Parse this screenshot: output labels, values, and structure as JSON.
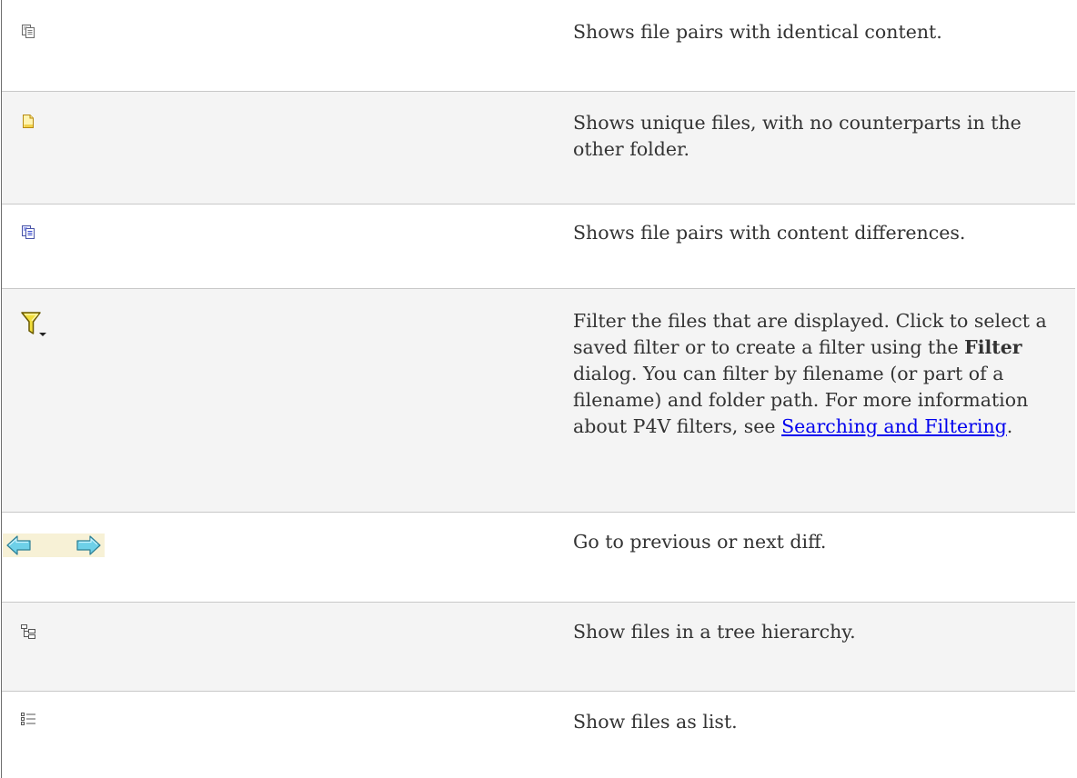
{
  "rows": [
    {
      "icon": "identical-files-icon",
      "description": "Shows file pairs with identical content."
    },
    {
      "icon": "unique-file-icon",
      "description": "Shows unique files, with no counterparts in the other folder."
    },
    {
      "icon": "different-files-icon",
      "description": "Shows file pairs with content differences."
    },
    {
      "icon": "filter-funnel-icon",
      "description_parts": {
        "before_bold": "Filter the files that are displayed. Click to select a saved filter or to create a filter using the ",
        "bold": "Filter",
        "after_bold": " dialog. You can filter by filename (or part of a filename) and folder path. For more information about P4V filters, see ",
        "link": "Searching and Filtering",
        "after_link": "."
      }
    },
    {
      "icon": "previous-next-arrows-icon",
      "description": "Go to previous or next diff."
    },
    {
      "icon": "tree-hierarchy-icon",
      "description": "Show files in a tree hierarchy."
    },
    {
      "icon": "list-view-icon",
      "description": "Show files as list."
    }
  ],
  "colors": {
    "text": "#333333",
    "link": "#0000ee",
    "row_alt_background": "#f4f4f4",
    "border": "#c8c8c8"
  }
}
